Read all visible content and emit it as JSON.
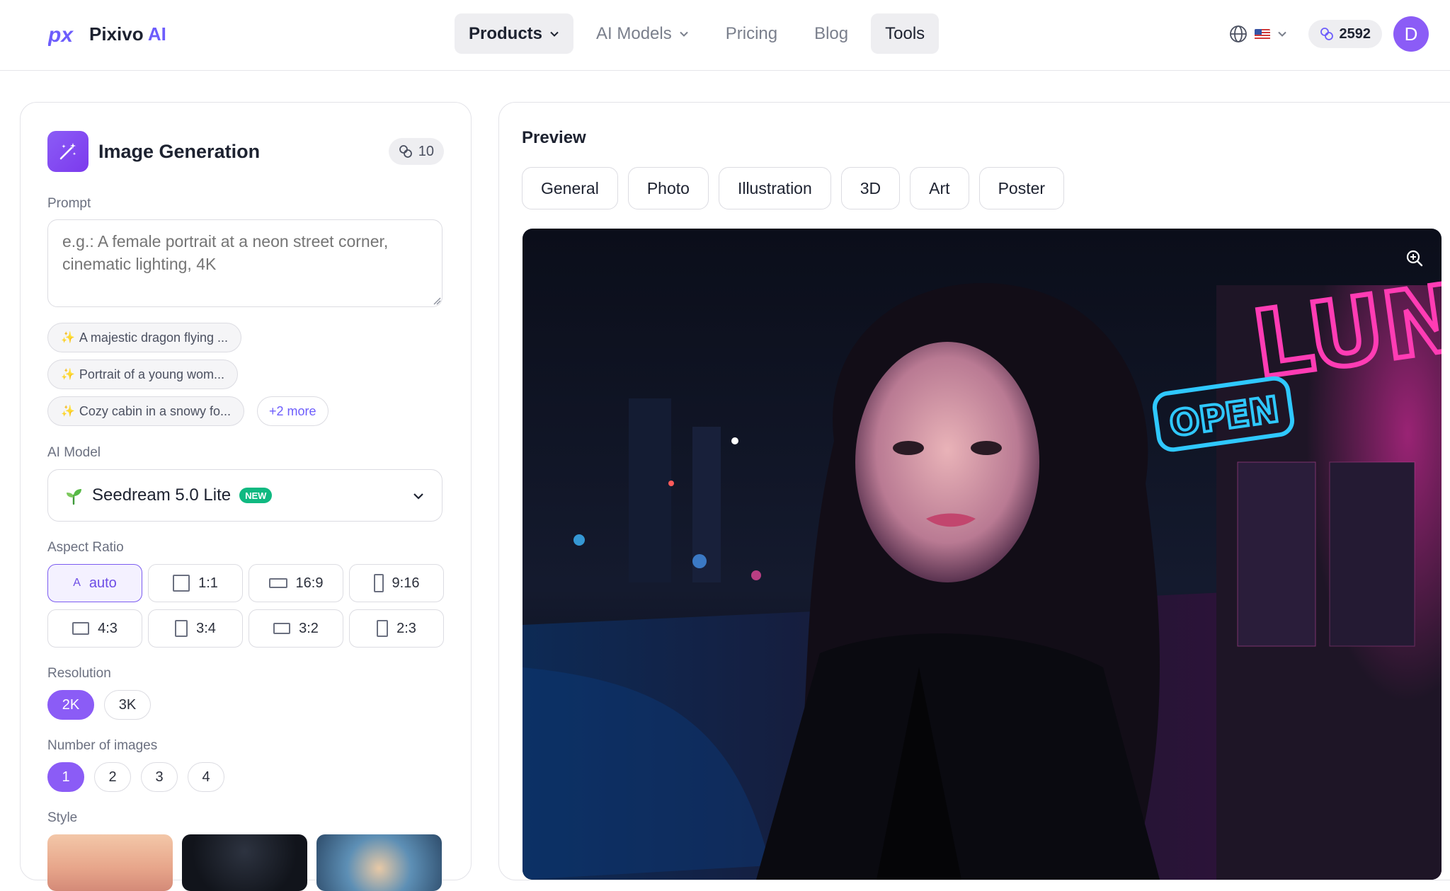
{
  "nav": {
    "brand_name": "Pixivo",
    "brand_suffix": "AI",
    "items": [
      {
        "label": "Products",
        "has_dropdown": true,
        "active": true
      },
      {
        "label": "AI Models",
        "has_dropdown": true
      },
      {
        "label": "Pricing"
      },
      {
        "label": "Blog"
      },
      {
        "label": "Tools",
        "highlighted": true
      }
    ],
    "language_icon": "globe-icon",
    "language_flag": "us-flag",
    "credits": "2592",
    "avatar_initial": "D",
    "avatar_color": "#8b5cf6"
  },
  "generator": {
    "title": "Image Generation",
    "cost": "10",
    "prompt_label": "Prompt",
    "prompt_placeholder": "e.g.: A female portrait at a neon street corner, cinematic lighting, 4K",
    "suggestions": [
      "A majestic dragon flying ...",
      "Portrait of a young wom...",
      "Cozy cabin in a snowy fo..."
    ],
    "more_suggestions": "+2 more",
    "model_label": "AI Model",
    "model_name": "Seedream 5.0 Lite",
    "model_badge": "NEW",
    "aspect_label": "Aspect Ratio",
    "aspect_ratios": [
      "auto",
      "1:1",
      "16:9",
      "9:16",
      "4:3",
      "3:4",
      "3:2",
      "2:3"
    ],
    "aspect_auto_glyph": "A",
    "aspect_selected": "auto",
    "resolution_label": "Resolution",
    "resolutions": [
      "2K",
      "3K"
    ],
    "resolution_selected": "2K",
    "count_label": "Number of images",
    "counts": [
      "1",
      "2",
      "3",
      "4"
    ],
    "count_selected": "1",
    "style_label": "Style",
    "accent_color": "#8b5cf6"
  },
  "preview": {
    "title": "Preview",
    "tabs": [
      "General",
      "Photo",
      "Illustration",
      "3D",
      "Art",
      "Poster"
    ],
    "sign_text": "LUNA",
    "sign_subtext": "OPEN",
    "zoom_icon": "zoom-in-icon"
  }
}
